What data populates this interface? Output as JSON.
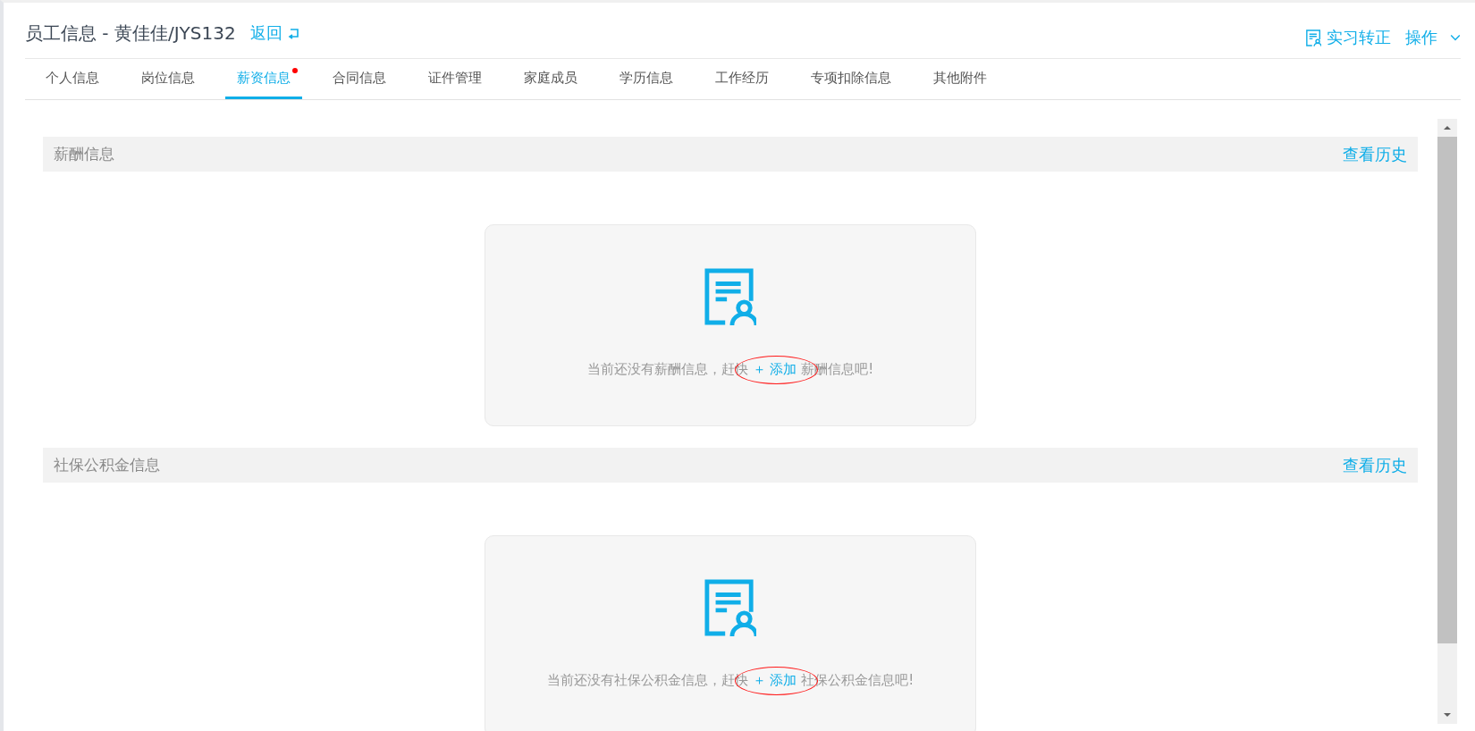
{
  "header": {
    "title": "员工信息 - 黄佳佳/JYS132",
    "back_link": "返回",
    "actions": [
      {
        "kind": "link",
        "label": "实习转正"
      },
      {
        "kind": "dropdown",
        "label": "操作"
      }
    ]
  },
  "tabs": [
    {
      "label": "个人信息",
      "selected": false,
      "dot": false
    },
    {
      "label": "岗位信息",
      "selected": false,
      "dot": false
    },
    {
      "label": "薪资信息",
      "selected": true,
      "dot": true
    },
    {
      "label": "合同信息",
      "selected": false,
      "dot": false
    },
    {
      "label": "证件管理",
      "selected": false,
      "dot": false
    },
    {
      "label": "家庭成员",
      "selected": false,
      "dot": false
    },
    {
      "label": "学历信息",
      "selected": false,
      "dot": false
    },
    {
      "label": "工作经历",
      "selected": false,
      "dot": false
    },
    {
      "label": "专项扣除信息",
      "selected": false,
      "dot": false
    },
    {
      "label": "其他附件",
      "selected": false,
      "dot": false
    }
  ],
  "sections": [
    {
      "title": "薪酬信息",
      "history_link": "查看历史",
      "empty_state": {
        "before": "当前还没有薪酬信息，赶快",
        "add_link": "＋ 添加",
        "after": "薪酬信息吧!",
        "annotated": true
      }
    },
    {
      "title": "社保公积金信息",
      "history_link": "查看历史",
      "empty_state": {
        "before": "当前还没有社保公积金信息，赶快",
        "add_link": "＋ 添加",
        "after": "社保公积金信息吧!",
        "annotated": true
      }
    }
  ]
}
